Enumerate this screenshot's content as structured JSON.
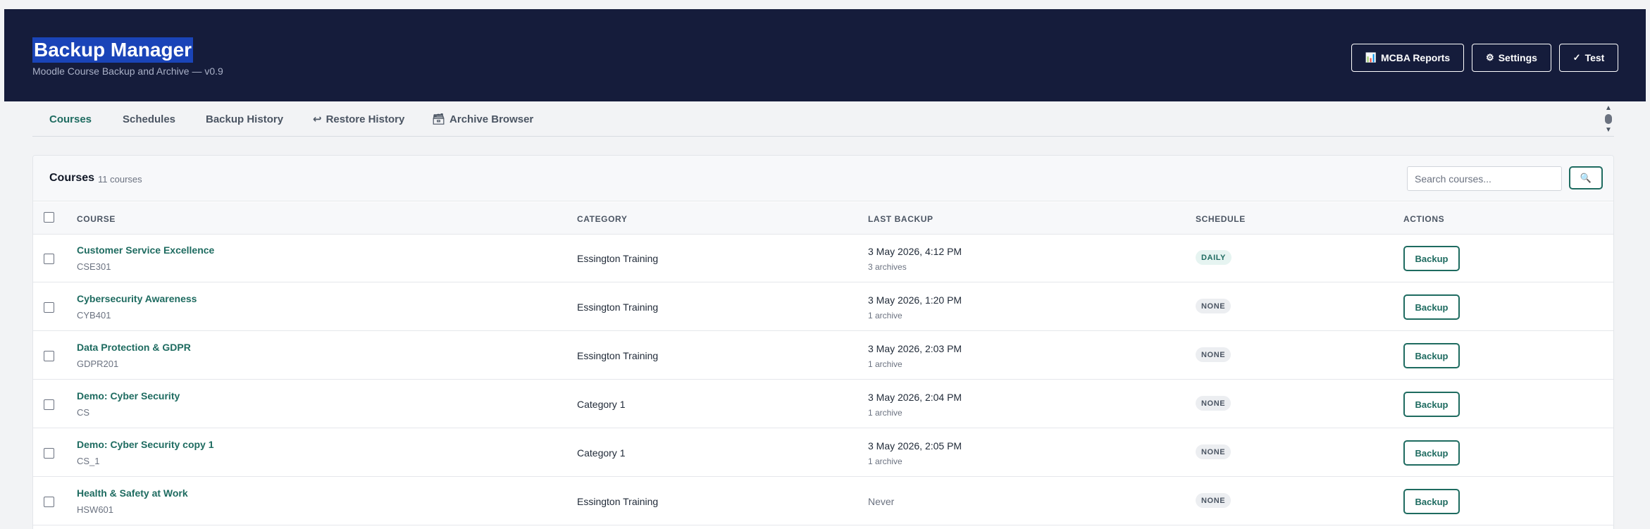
{
  "header": {
    "title": "Backup Manager",
    "subtitle": "Moodle Course Backup and Archive — v0.9",
    "buttons": [
      {
        "icon": "📊",
        "label": "MCBA Reports"
      },
      {
        "icon": "⚙",
        "label": "Settings"
      },
      {
        "icon": "✓",
        "label": "Test"
      }
    ]
  },
  "nav": {
    "tabs": [
      {
        "label": "Courses",
        "icon": ""
      },
      {
        "label": "Schedules",
        "icon": ""
      },
      {
        "label": "Backup History",
        "icon": ""
      },
      {
        "label": "Restore History",
        "icon": "↩"
      },
      {
        "label": "Archive Browser",
        "icon": "🗃"
      }
    ],
    "active": "Courses"
  },
  "courses": {
    "title": "Courses",
    "count": "11 courses",
    "search_placeholder": "Search courses...",
    "search_icon": "🔍",
    "columns": [
      "COURSE",
      "CATEGORY",
      "LAST BACKUP",
      "SCHEDULE",
      "ACTIONS"
    ],
    "rows": [
      {
        "name": "Customer Service Excellence",
        "code": "CSE301",
        "category": "Essington Training",
        "last_backup": "3 May 2026, 4:12 PM",
        "archives": "3 archives",
        "schedule": "DAILY",
        "action": "Backup"
      },
      {
        "name": "Cybersecurity Awareness",
        "code": "CYB401",
        "category": "Essington Training",
        "last_backup": "3 May 2026, 1:20 PM",
        "archives": "1 archive",
        "schedule": "NONE",
        "action": "Backup"
      },
      {
        "name": "Data Protection & GDPR",
        "code": "GDPR201",
        "category": "Essington Training",
        "last_backup": "3 May 2026, 2:03 PM",
        "archives": "1 archive",
        "schedule": "NONE",
        "action": "Backup"
      },
      {
        "name": "Demo: Cyber Security",
        "code": "CS",
        "category": "Category 1",
        "last_backup": "3 May 2026, 2:04 PM",
        "archives": "1 archive",
        "schedule": "NONE",
        "action": "Backup"
      },
      {
        "name": "Demo: Cyber Security copy 1",
        "code": "CS_1",
        "category": "Category 1",
        "last_backup": "3 May 2026, 2:05 PM",
        "archives": "1 archive",
        "schedule": "NONE",
        "action": "Backup"
      },
      {
        "name": "Health & Safety at Work",
        "code": "HSW601",
        "category": "Essington Training",
        "last_backup": "Never",
        "archives": "",
        "schedule": "NONE",
        "action": "Backup"
      }
    ]
  },
  "colors": {
    "header_bg": "#151c3b",
    "accent": "#1e6b60",
    "title_highlight": "#1a44b8"
  }
}
